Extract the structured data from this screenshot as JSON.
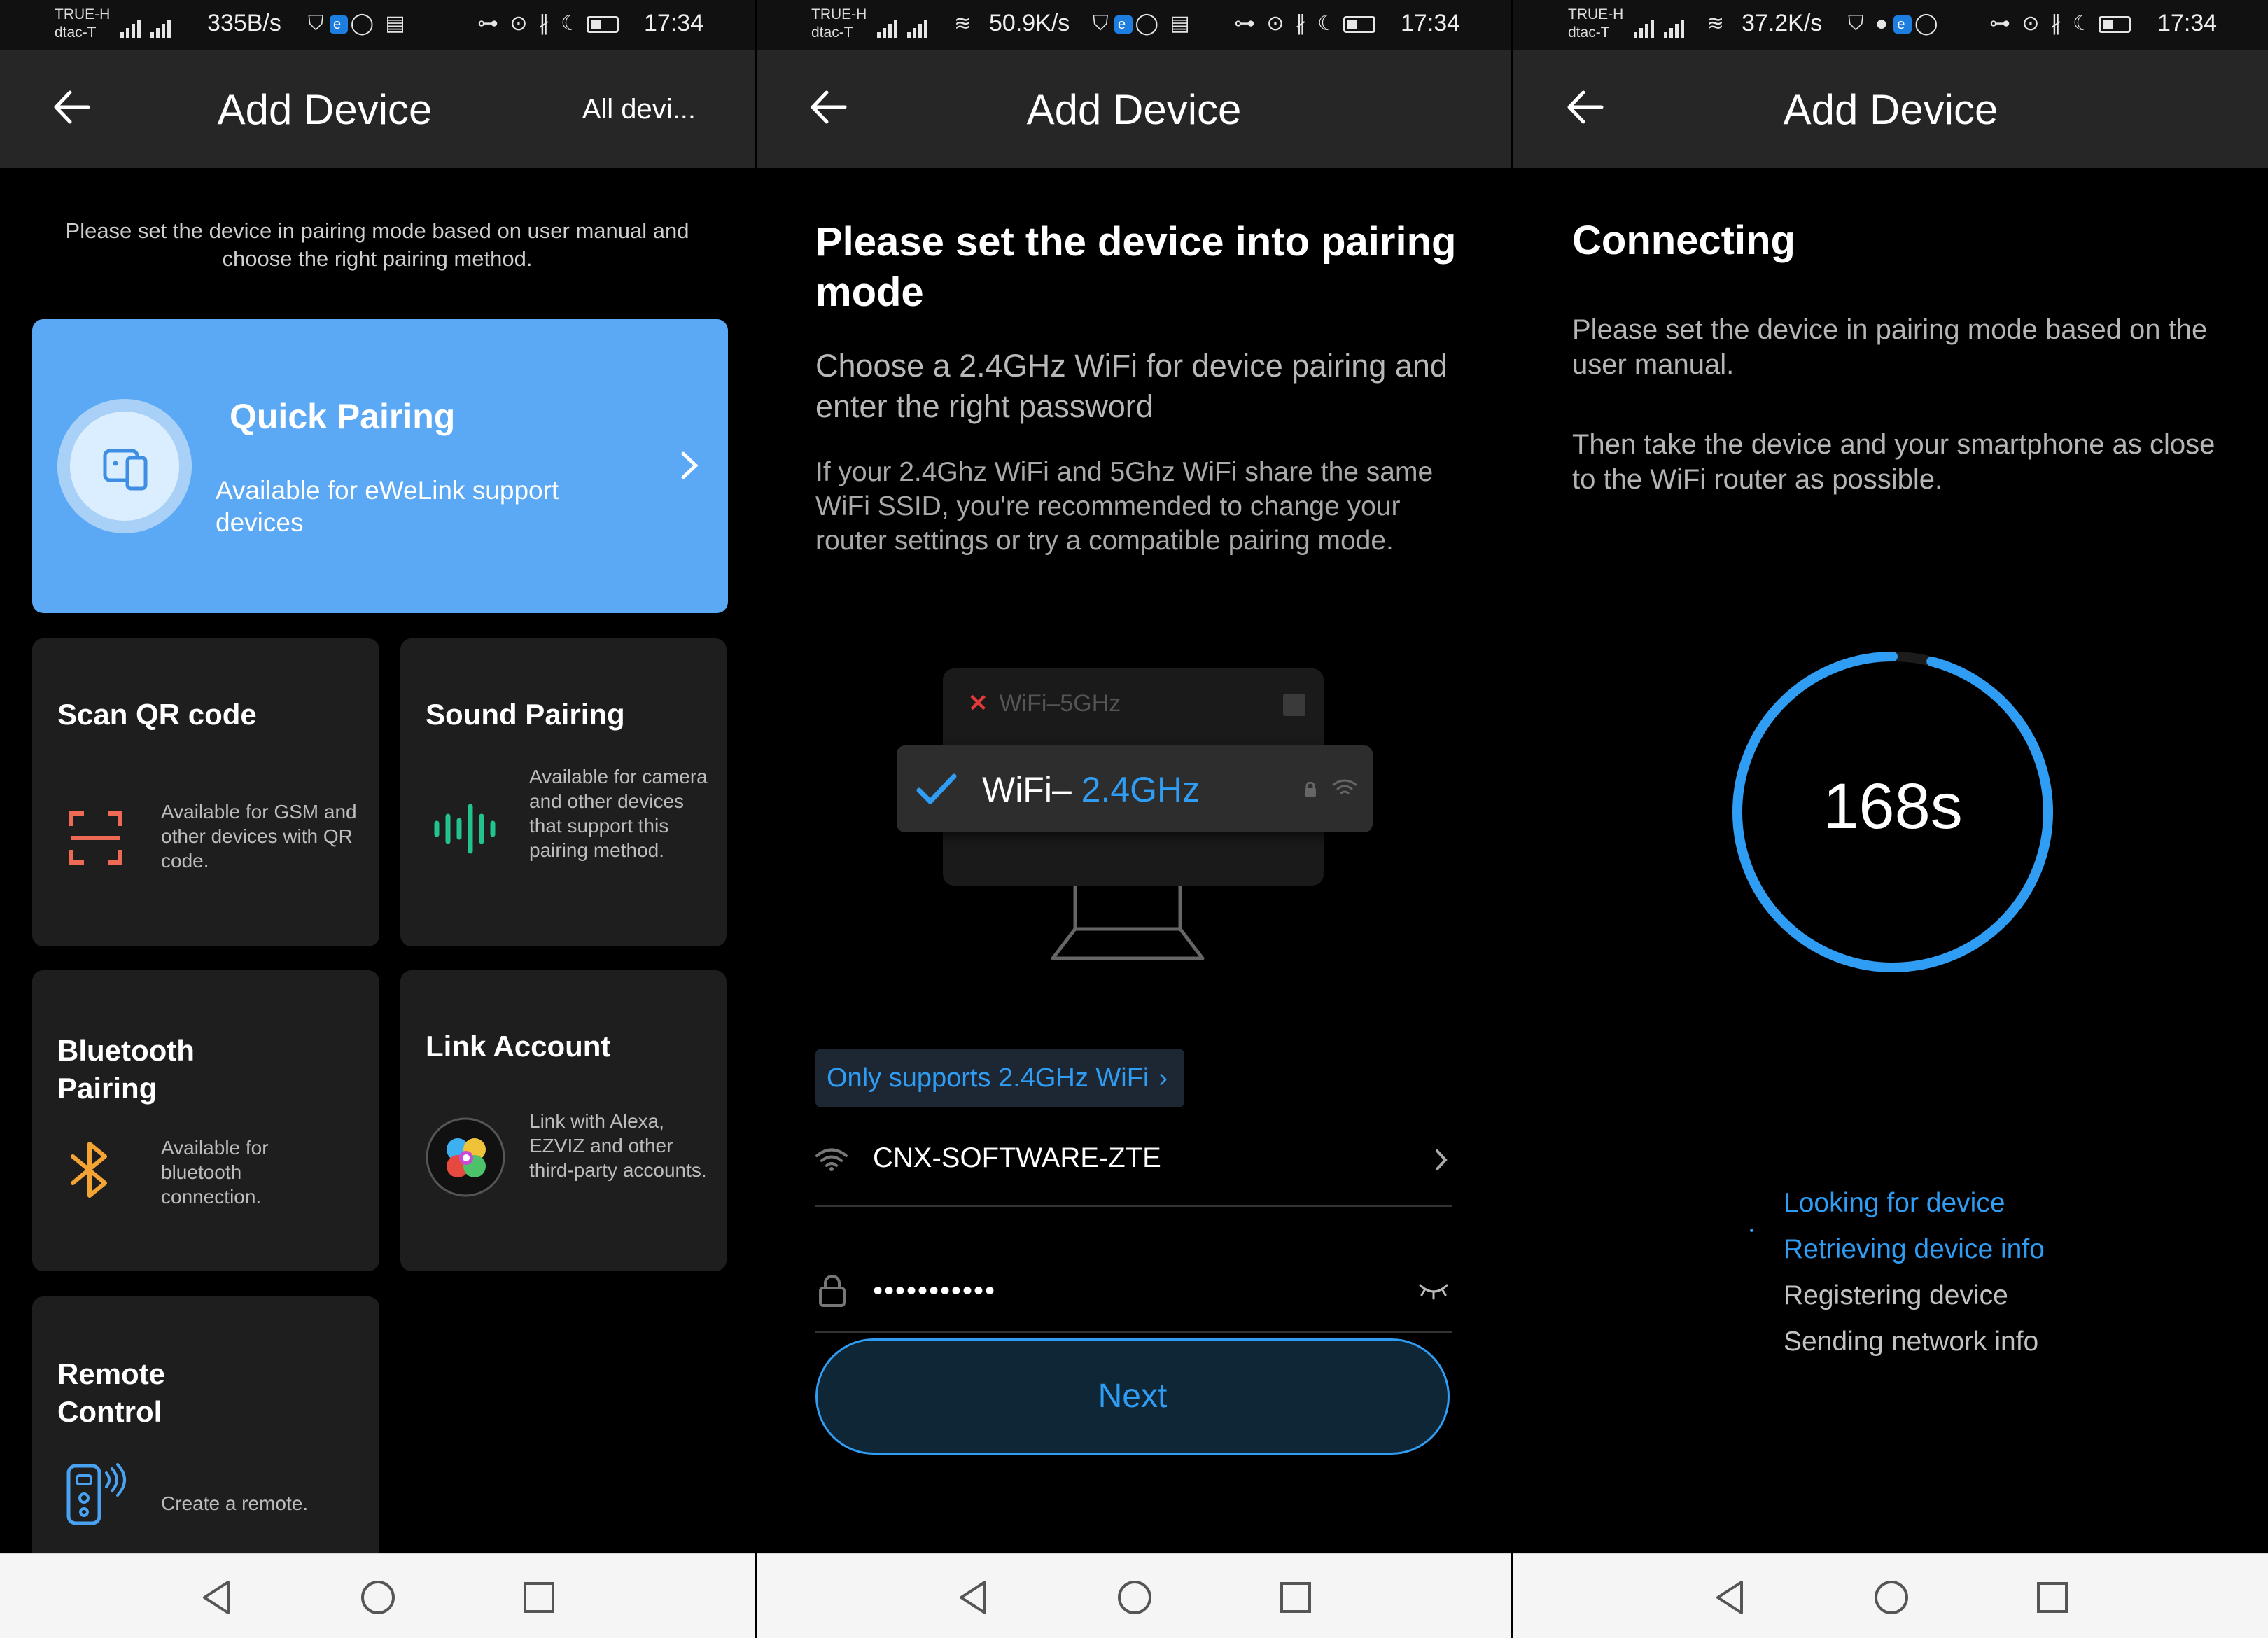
{
  "status_bars": [
    {
      "carrier": [
        "TRUE-H",
        "dtac-T"
      ],
      "speed": "335B/s",
      "time": "17:34"
    },
    {
      "carrier": [
        "TRUE-H",
        "dtac-T"
      ],
      "speed": "50.9K/s",
      "time": "17:34"
    },
    {
      "carrier": [
        "TRUE-H",
        "dtac-T"
      ],
      "speed": "37.2K/s",
      "time": "17:34"
    }
  ],
  "screen1": {
    "title": "Add Device",
    "right_action": "All devi...",
    "intro": "Please set the device in pairing mode based on user manual and choose the right pairing method.",
    "quick": {
      "title": "Quick Pairing",
      "desc": "Available for eWeLink support devices",
      "icon": "device-phone-icon"
    },
    "cards": [
      {
        "title": "Scan QR code",
        "desc": "Available for GSM and other devices with QR code.",
        "icon": "qr-scan-icon"
      },
      {
        "title": "Sound Pairing",
        "desc": "Available for camera and other devices that support this pairing method.",
        "icon": "sound-wave-icon"
      },
      {
        "title": "Bluetooth Pairing",
        "desc": "Available for bluetooth connection.",
        "icon": "bluetooth-icon"
      },
      {
        "title": "Link Account",
        "desc": "Link with Alexa, EZVIZ and other third-party accounts.",
        "icon": "link-account-icon"
      },
      {
        "title": "Remote Control",
        "desc": "Create a remote.",
        "icon": "remote-control-icon"
      }
    ]
  },
  "screen2": {
    "title": "Add Device",
    "heading": "Please set the device into pairing mode",
    "subheading": "Choose a 2.4GHz WiFi for device pairing and enter the right password",
    "note": "If your 2.4Ghz WiFi and 5Ghz WiFi share the same WiFi SSID, you're recommended to change your router settings or try a compatible pairing mode.",
    "illustration": {
      "bad_option": "WiFi–5GHz",
      "good_prefix": "WiFi– ",
      "good_band": "2.4GHz"
    },
    "only_supports": "Only supports 2.4GHz WiFi",
    "ssid": "CNX-SOFTWARE-ZTE",
    "password_masked": "•••••••••••",
    "next_label": "Next",
    "accent": "#2f9df4"
  },
  "screen3": {
    "title": "Add Device",
    "heading": "Connecting",
    "p1": "Please set the device in pairing mode based on the user manual.",
    "p2": "Then take the device and your smartphone as close to the WiFi router as possible.",
    "countdown": "168s",
    "progress_fraction": 0.96,
    "steps": [
      {
        "label": "Looking for device",
        "state": "active"
      },
      {
        "label": "Retrieving device info",
        "state": "active"
      },
      {
        "label": "Registering device",
        "state": "idle"
      },
      {
        "label": "Sending network info",
        "state": "idle"
      }
    ]
  }
}
